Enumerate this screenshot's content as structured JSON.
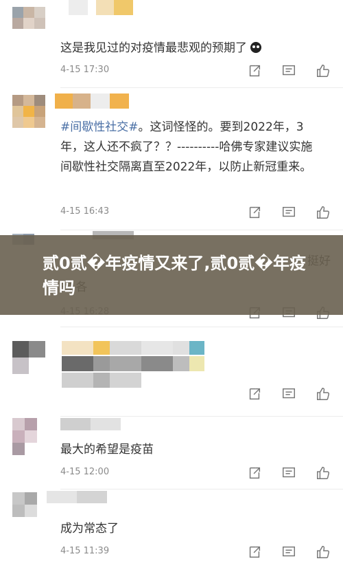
{
  "comments": [
    {
      "text": "这是我见过的对疫情最悲观的预期了",
      "time": "4-15 17:30"
    },
    {
      "tag": "#间歇性社交#",
      "text": "。这词怪怪的。要到2022年，3年，这人还不疯了？？----------哈佛专家建议实施间歇性社交隔离直至2022年，以防止新冠重来。",
      "time": "4-15 16:43"
    },
    {
      "text_left": "的 各",
      "text_right": "挺好",
      "time": "4-15 16:28"
    },
    {
      "text": "",
      "time": ""
    },
    {
      "text": "最大的希望是疫苗",
      "time": "4-15 12:00"
    },
    {
      "text": "成为常态了",
      "time": "4-15 11:39"
    }
  ],
  "banner": {
    "title": "贰0贰�年疫情又来了,贰0贰�年疫情吗"
  },
  "icons": {
    "share": "share-icon",
    "reply": "comment-icon",
    "like": "thumbs-up-icon",
    "emoji": "emoji-face-icon"
  }
}
